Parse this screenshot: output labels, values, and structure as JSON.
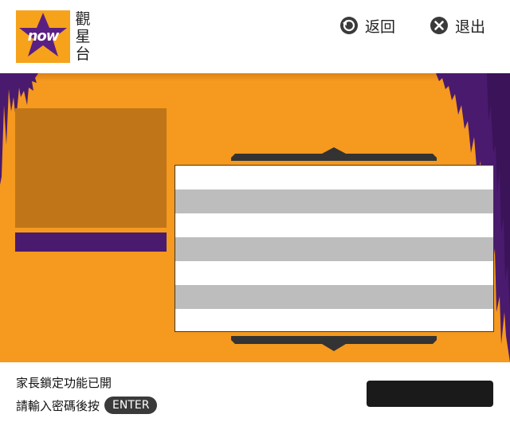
{
  "header": {
    "logo_text": "now",
    "channel_name_chars": [
      "觀",
      "星",
      "台"
    ],
    "back_label": "返回",
    "exit_label": "退出",
    "back_icon": "back-arrow-icon",
    "exit_icon": "close-icon"
  },
  "colors": {
    "brand_orange": "#f5991f",
    "brand_purple": "#4a1a6e",
    "row_alt": "#bdbdbd",
    "thumb": "#c07618"
  },
  "list": {
    "rows": [
      "",
      "",
      "",
      "",
      "",
      "",
      ""
    ]
  },
  "footer": {
    "lock_message_line1": "家長鎖定功能已開",
    "lock_message_line2": "請輸入密碼後按",
    "enter_key": "ENTER",
    "pin_value": ""
  }
}
